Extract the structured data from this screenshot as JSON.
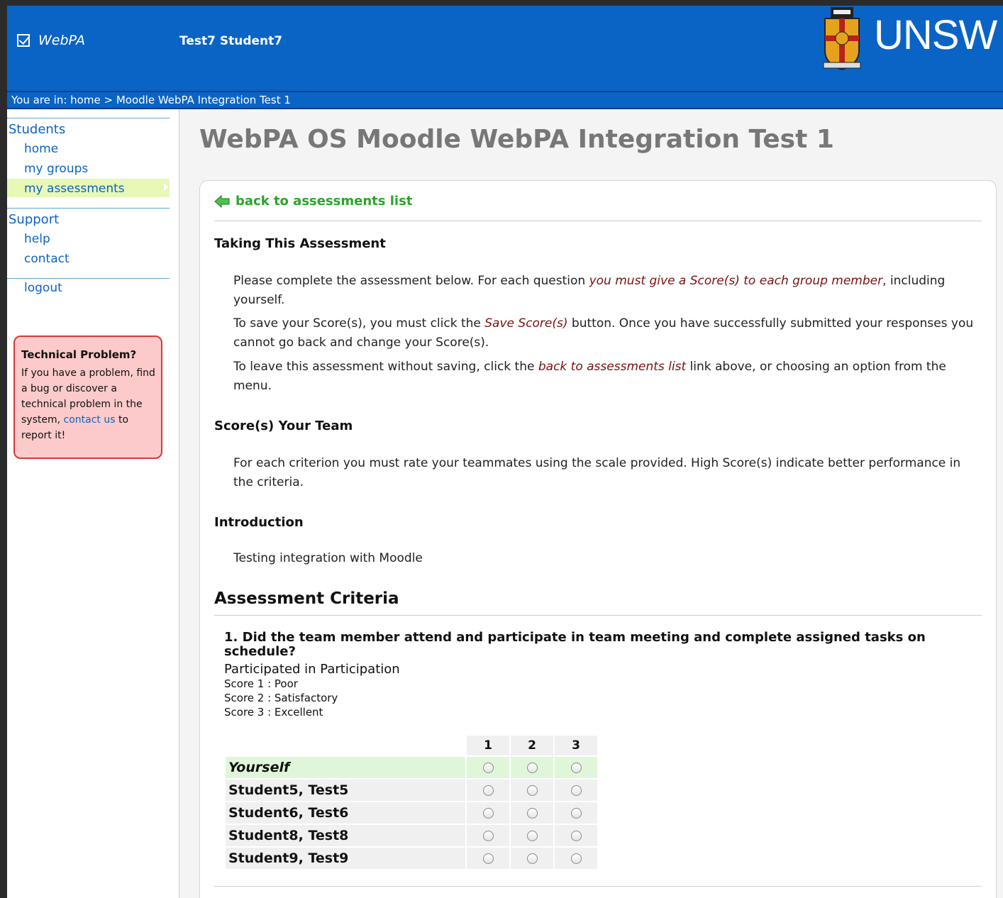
{
  "header": {
    "app_name": "WebPA",
    "user_name": "Test7 Student7",
    "brand": "UNSW",
    "bg_color": "#0a64c6"
  },
  "breadcrumb": {
    "prefix": "You are in:",
    "home": "home",
    "separator": ">",
    "current": "Moodle WebPA Integration Test 1"
  },
  "sidebar": {
    "students_heading": "Students",
    "home": "home",
    "my_groups": "my groups",
    "my_assessments": "my assessments",
    "support_heading": "Support",
    "help": "help",
    "contact": "contact",
    "logout": "logout",
    "tech_box": {
      "title": "Technical Problem?",
      "text_before": "If you have a problem, find a bug or discover a technical problem in the system,",
      "link": "contact us",
      "text_after": "to report it!"
    }
  },
  "main": {
    "page_title": "WebPA OS Moodle WebPA Integration Test 1",
    "back_link": "back to assessments list",
    "taking_heading": "Taking This Assessment",
    "p1_a": "Please complete the assessment below. For each question ",
    "p1_em": "you must give a Score(s) to each group member",
    "p1_b": ", including yourself.",
    "p2_a": "To save your Score(s), you must click the ",
    "p2_em": "Save Score(s)",
    "p2_b": " button. Once you have successfully submitted your responses you cannot go back and change your Score(s).",
    "p3_a": "To leave this assessment without saving, click the ",
    "p3_em": "back to assessments list",
    "p3_b": " link above, or choosing an option from the menu.",
    "score_heading": "Score(s) Your Team",
    "score_para": "For each criterion you must rate your teammates using the scale provided. High Score(s) indicate better performance in the criteria.",
    "intro_heading": "Introduction",
    "intro_para": "Testing integration with Moodle",
    "criteria_heading": "Assessment Criteria",
    "question": "1. Did the team member attend and participate in team meeting and complete assigned tasks on schedule?",
    "question_sub": "Participated in Participation",
    "scores": [
      "Score 1 : Poor",
      "Score 2 : Satisfactory",
      "Score 3 : Excellent"
    ],
    "table": {
      "columns": [
        "1",
        "2",
        "3"
      ],
      "rows": [
        "Yourself",
        "Student5, Test5",
        "Student6, Test6",
        "Student8, Test8",
        "Student9, Test9"
      ]
    }
  }
}
